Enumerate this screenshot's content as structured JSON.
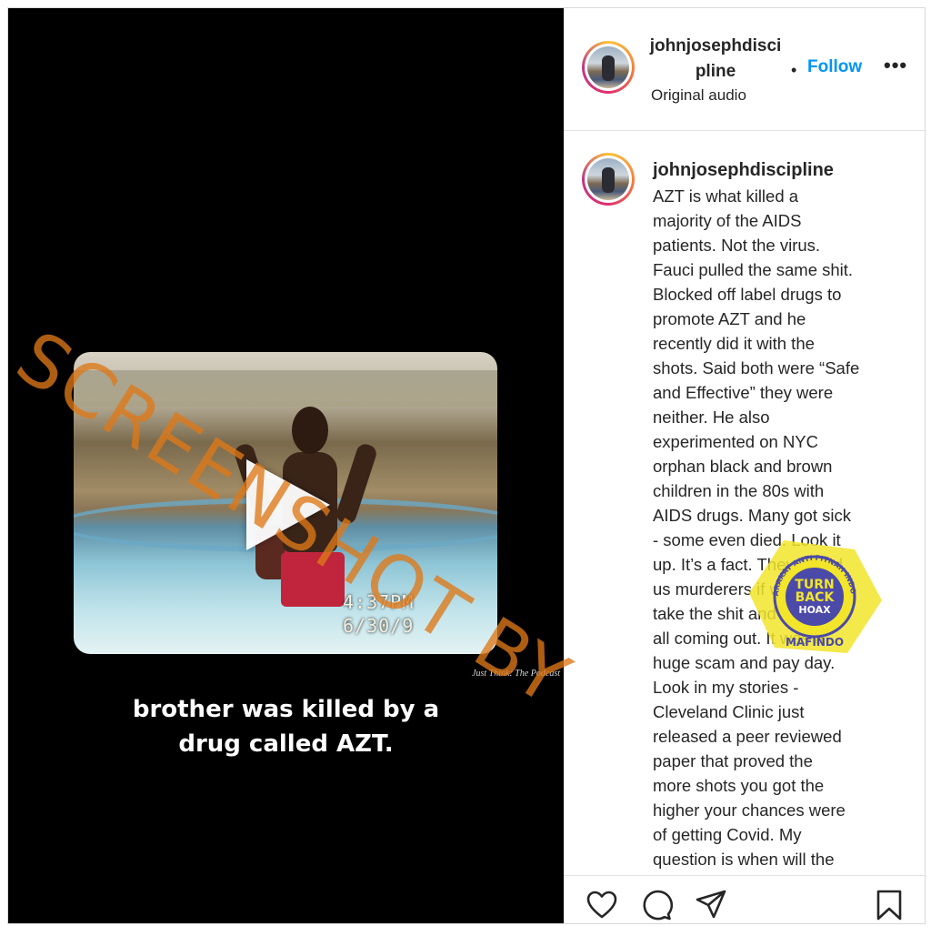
{
  "video": {
    "timestamp_time": "4:37PM",
    "timestamp_date": "6/30/9",
    "credit": "Just Think: The Podcast",
    "caption": "brother was killed by a\ndrug called AZT."
  },
  "header": {
    "username": "johnjosephdiscipline",
    "separator": "•",
    "follow_label": "Follow",
    "more_label": "•••",
    "audio_label": "Original audio"
  },
  "comment": {
    "username": "johnjosephdiscipline",
    "text": "AZT is what killed a\nmajority of the AIDS\npatients. Not the virus.\nFauci pulled the same shit.\nBlocked off label drugs to\npromote AZT and he\nrecently did it with the\nshots. Said both were “Safe\nand Effective” they were\nneither. He also\nexperimented on NYC\norphan black and brown\nchildren in the 80s with\nAIDS drugs. Many got sick\n- some even died. Look it\nup. It’s a fact. They called\nus murderers if we didn’t\ntake the shit and now it’s\nall coming out. It was a\nhuge scam and pay day.\nLook in my stories -\nCleveland Clinic just\nreleased a peer reviewed\npaper that proved the\nmore shots you got the\nhigher your chances were\nof getting Covid. My\nquestion is when will the\npeople responsible pay the"
  },
  "actions": {
    "like_icon": "heart-icon",
    "comment_icon": "comment-icon",
    "share_icon": "share-icon",
    "save_icon": "bookmark-icon"
  },
  "watermark": {
    "text": "SCREENSHOT BY",
    "badge_top": "MASYARAKAT ANTI FITNAH INDONESIA",
    "badge_line1": "TURN",
    "badge_line2": "BACK",
    "badge_line3": "HOAX",
    "badge_bottom": "MAFINDO",
    "badge_color": "#f2e52a",
    "badge_inner_color": "#4b4aa8"
  },
  "colors": {
    "follow": "#0095f6",
    "watermark": "#de7818"
  }
}
